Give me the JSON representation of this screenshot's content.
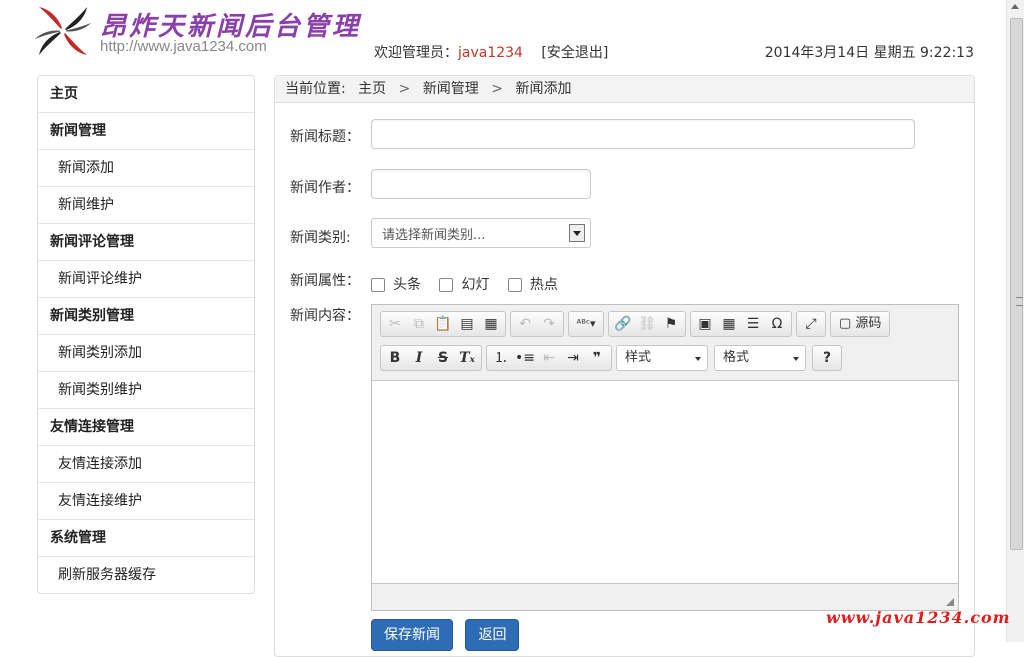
{
  "header": {
    "logo_title": "昂炸天新闻后台管理",
    "logo_url": "http://www.java1234.com",
    "welcome_label": "欢迎管理员：",
    "username": "java1234",
    "logout_label": "[安全退出]",
    "datetime": "2014年3月14日 星期五 9:22:13"
  },
  "sidebar": {
    "items": [
      {
        "label": "主页",
        "type": "head"
      },
      {
        "label": "新闻管理",
        "type": "head"
      },
      {
        "label": "新闻添加",
        "type": "sub"
      },
      {
        "label": "新闻维护",
        "type": "sub"
      },
      {
        "label": "新闻评论管理",
        "type": "head"
      },
      {
        "label": "新闻评论维护",
        "type": "sub"
      },
      {
        "label": "新闻类别管理",
        "type": "head"
      },
      {
        "label": "新闻类别添加",
        "type": "sub"
      },
      {
        "label": "新闻类别维护",
        "type": "sub"
      },
      {
        "label": "友情连接管理",
        "type": "head"
      },
      {
        "label": "友情连接添加",
        "type": "sub"
      },
      {
        "label": "友情连接维护",
        "type": "sub"
      },
      {
        "label": "系统管理",
        "type": "head"
      },
      {
        "label": "刷新服务器缓存",
        "type": "sub"
      }
    ]
  },
  "breadcrumb": {
    "prefix": "当前位置:",
    "items": [
      "主页",
      "新闻管理",
      "新闻添加"
    ],
    "separator": ">"
  },
  "form": {
    "title_label": "新闻标题：",
    "title_value": "",
    "author_label": "新闻作者：",
    "author_value": "",
    "category_label": "新闻类别:",
    "category_selected": "请选择新闻类别...",
    "attributes_label": "新闻属性：",
    "attributes": [
      {
        "label": "头条",
        "checked": false
      },
      {
        "label": "幻灯",
        "checked": false
      },
      {
        "label": "热点",
        "checked": false
      }
    ],
    "content_label": "新闻内容：",
    "editor": {
      "source_label": "源码",
      "style_combo": "样式",
      "format_combo": "格式",
      "help_label": "?"
    }
  },
  "actions": {
    "save_label": "保存新闻",
    "back_label": "返回"
  },
  "watermark": "www.java1234.com",
  "colors": {
    "accent_blue": "#2e6cb5",
    "username_red": "#c0392b",
    "logo_purple": "#8b3fa8",
    "watermark_red": "#e21c1c"
  }
}
